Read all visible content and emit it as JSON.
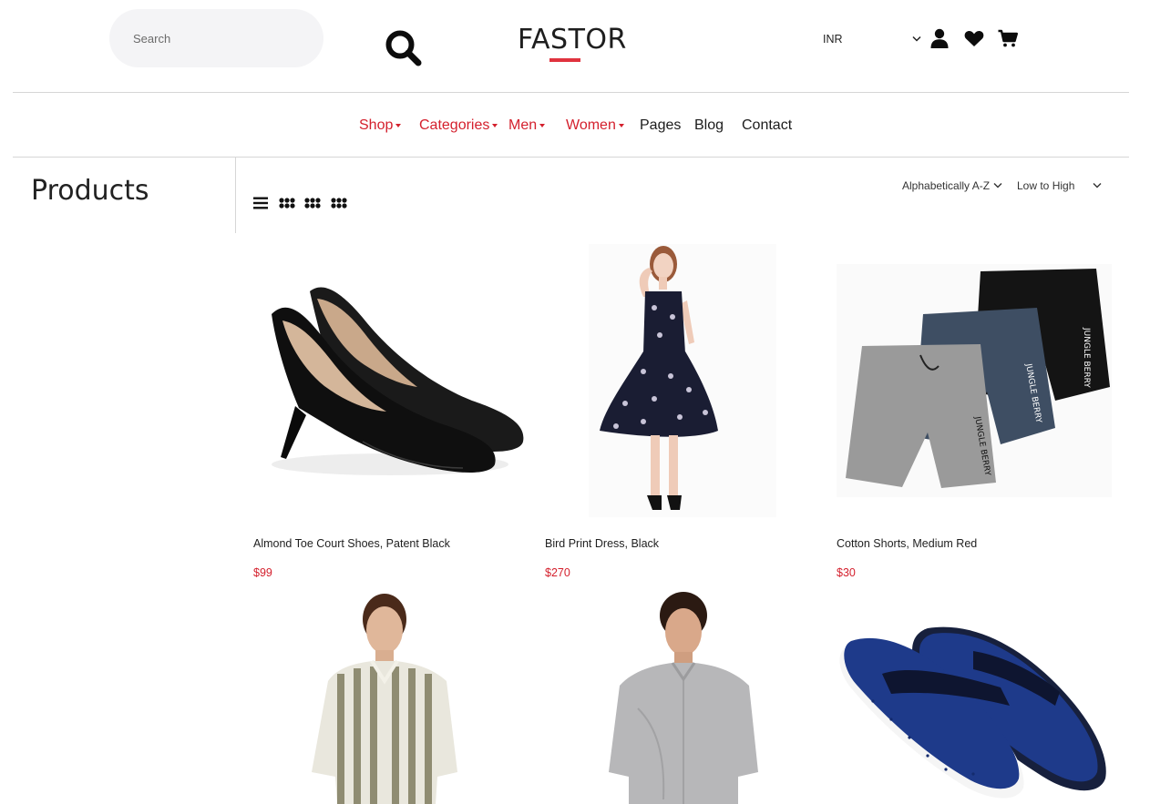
{
  "header": {
    "search_placeholder": "Search",
    "logo": "FASTOR",
    "currency": "INR"
  },
  "nav": {
    "items": [
      {
        "label": "Shop",
        "dropdown": true
      },
      {
        "label": "Categories",
        "dropdown": true
      },
      {
        "label": "Men",
        "dropdown": true
      },
      {
        "label": "Women",
        "dropdown": true
      },
      {
        "label": "Pages",
        "dropdown": false
      },
      {
        "label": "Blog",
        "dropdown": false
      },
      {
        "label": "Contact",
        "dropdown": false
      }
    ]
  },
  "sidebar": {
    "title": "Products"
  },
  "sort": {
    "order": "Alphabetically A-Z",
    "price": "Low to High"
  },
  "products": [
    {
      "name": "Almond Toe Court Shoes, Patent Black",
      "price": "$99"
    },
    {
      "name": "Bird Print Dress, Black",
      "price": "$270"
    },
    {
      "name": "Cotton Shorts, Medium Red",
      "price": "$30"
    },
    {
      "name": "",
      "price": ""
    },
    {
      "name": "",
      "price": ""
    },
    {
      "name": "",
      "price": ""
    }
  ],
  "colors": {
    "accent": "#d4202d",
    "search_bg": "#f4f4f6",
    "rule": "#d6d6d6"
  },
  "icons": [
    "search-icon",
    "user-icon",
    "heart-icon",
    "cart-icon",
    "list-view-icon",
    "grid-2-icon",
    "grid-3-icon",
    "grid-4-icon",
    "chevron-down-icon"
  ]
}
